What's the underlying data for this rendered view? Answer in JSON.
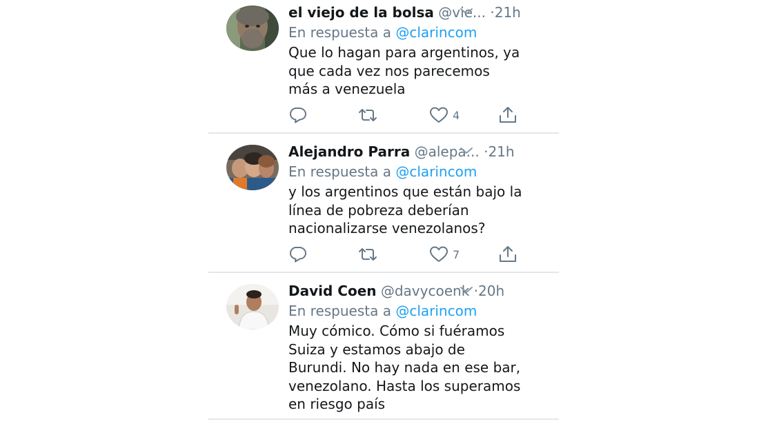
{
  "colors": {
    "text": "#14171a",
    "secondary": "#657786",
    "link": "#1da1f2",
    "divider": "#e3e6ea"
  },
  "tweets": [
    {
      "name": "el viejo de la bolsa",
      "handle": "@vie...",
      "separator": "·",
      "time": "21h",
      "reply_prefix": "En respuesta a",
      "reply_mention": "@clarincom",
      "text": "Que lo hagan para argentinos, ya\nque cada vez nos parecemos\nmás a venezuela",
      "like_count": "4",
      "icons": [
        "reply-icon",
        "retweet-icon",
        "heart-icon",
        "share-icon",
        "chevron-down-icon"
      ]
    },
    {
      "name": "Alejandro Parra",
      "handle": "@alepa...",
      "separator": "·",
      "time": "21h",
      "reply_prefix": "En respuesta a",
      "reply_mention": "@clarincom",
      "text": "y los argentinos que están bajo la\nlínea de pobreza deberían\nnacionalizarse venezolanos?",
      "like_count": "7",
      "icons": [
        "reply-icon",
        "retweet-icon",
        "heart-icon",
        "share-icon",
        "chevron-down-icon"
      ]
    },
    {
      "name": "David Coen",
      "handle": "@davycoenk",
      "separator": "·",
      "time": "20h",
      "reply_prefix": "En respuesta a",
      "reply_mention": "@clarincom",
      "text": "Muy cómico. Cómo si fuéramos\nSuiza y estamos abajo de\nBurundi.  No hay nada en ese bar,\nvenezolano. Hasta los superamos\nen riesgo país",
      "icons": [
        "chevron-down-icon"
      ]
    }
  ]
}
